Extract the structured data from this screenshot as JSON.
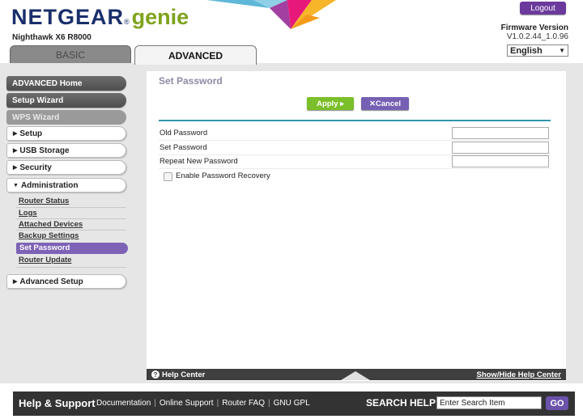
{
  "header": {
    "brand_primary": "NETGEAR",
    "brand_reg": "®",
    "brand_secondary": "genie",
    "model": "Nighthawk X6 R8000",
    "logout_label": "Logout",
    "firmware_label": "Firmware Version",
    "firmware_value": "V1.0.2.44_1.0.96",
    "language": "English"
  },
  "tabs": [
    {
      "label": "BASIC",
      "active": false
    },
    {
      "label": "ADVANCED",
      "active": true
    }
  ],
  "sidebar": {
    "items": [
      {
        "label": "ADVANCED Home",
        "style": "dark"
      },
      {
        "label": "Setup Wizard",
        "style": "dark"
      },
      {
        "label": "WPS Wizard",
        "style": "disabled"
      },
      {
        "label": "Setup",
        "style": "light",
        "expanded": false
      },
      {
        "label": "USB Storage",
        "style": "light",
        "expanded": false
      },
      {
        "label": "Security",
        "style": "light",
        "expanded": false
      },
      {
        "label": "Administration",
        "style": "light",
        "expanded": true
      },
      {
        "label": "Advanced Setup",
        "style": "light",
        "expanded": false
      }
    ],
    "admin_subitems": [
      {
        "label": "Router Status"
      },
      {
        "label": "Logs"
      },
      {
        "label": "Attached Devices"
      },
      {
        "label": "Backup Settings"
      },
      {
        "label": "Set Password",
        "selected": true
      },
      {
        "label": "Router Update"
      }
    ]
  },
  "content": {
    "title": "Set Password",
    "apply_label": "Apply ▸",
    "cancel_label": "✕Cancel",
    "fields": [
      {
        "label": "Old Password",
        "value": ""
      },
      {
        "label": "Set Password",
        "value": ""
      },
      {
        "label": "Repeat New Password",
        "value": ""
      }
    ],
    "recovery_label": "Enable Password Recovery",
    "recovery_checked": false
  },
  "help_bar": {
    "help_center_label": "Help Center",
    "show_hide_label": "Show/Hide Help Center"
  },
  "footer": {
    "title": "Help & Support",
    "links": [
      "Documentation",
      "Online Support",
      "Router FAQ",
      "GNU GPL"
    ],
    "search_label": "SEARCH HELP",
    "search_value": "Enter Search Item",
    "go_label": "GO"
  },
  "colors": {
    "brand_blue": "#1a2f6b",
    "genie_green": "#7ea31c",
    "accent_purple": "#7660b4",
    "apply_green": "#7bbf2a",
    "divider_teal": "#2f98a8"
  }
}
